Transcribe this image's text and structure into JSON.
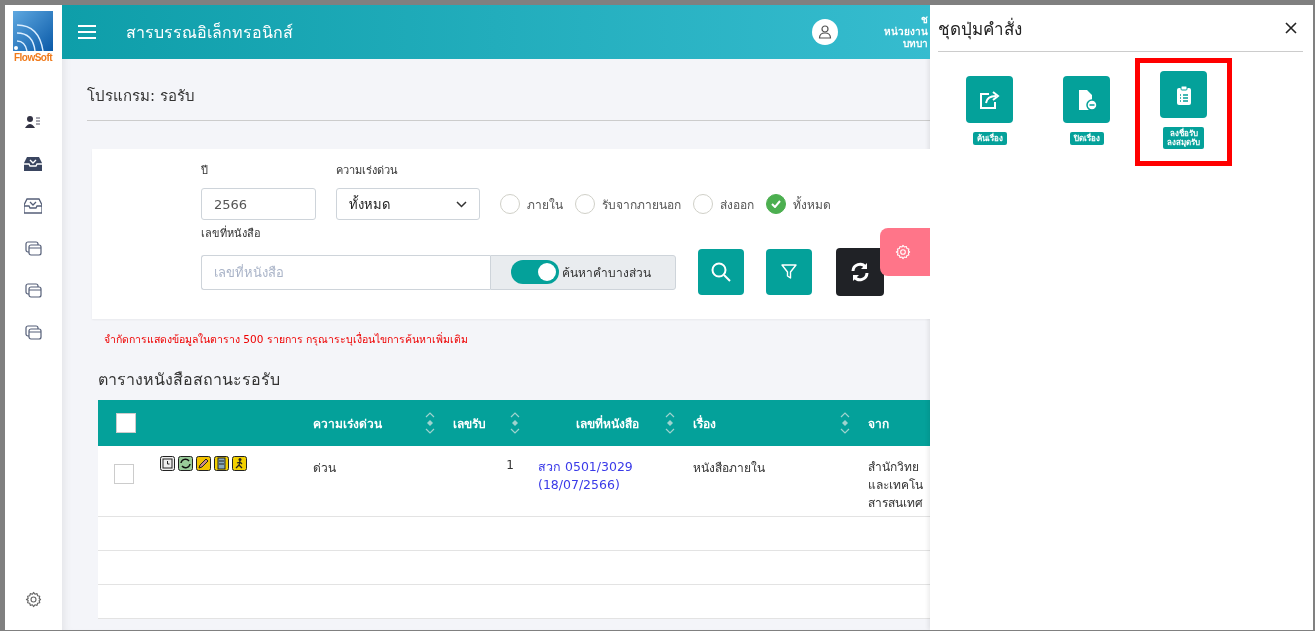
{
  "logo": {
    "text": "FlowSoft"
  },
  "header": {
    "title": "สารบรรณอิเล็กทรอนิกส์",
    "user_lines": [
      "ช",
      "หน่วยงาน",
      "บทบา"
    ]
  },
  "page": {
    "title": "โปรแกรม: รอรับ"
  },
  "filters": {
    "year": {
      "label": "ปี",
      "value": "2566"
    },
    "urgency": {
      "label": "ความเร่งด่วน",
      "value": "ทั้งหมด"
    },
    "sources": [
      {
        "label": "ภายใน",
        "selected": false
      },
      {
        "label": "รับจากภายนอก",
        "selected": false
      },
      {
        "label": "ส่งออก",
        "selected": false
      },
      {
        "label": "ทั้งหมด",
        "selected": true
      }
    ],
    "doc_number": {
      "label": "เลขที่หนังสือ",
      "placeholder": "เลขที่หนังสือ"
    },
    "partial_search": {
      "label": "ค้นหาคำบางส่วน",
      "on": true
    }
  },
  "notice": "จำกัดการแสดงข้อมูลในตาราง 500 รายการ กรุณาระบุเงื่อนไขการค้นหาเพิ่มเติม",
  "table": {
    "title": "ตารางหนังสือสถานะรอรับ",
    "all_checked": false,
    "columns": [
      {
        "label": "ความเร่งด่วน",
        "sortable": true
      },
      {
        "label": "เลขรับ",
        "sortable": true
      },
      {
        "label": "เลขที่หนังสือ",
        "sortable": true
      },
      {
        "label": "เรื่อง",
        "sortable": true
      },
      {
        "label": "จาก",
        "sortable": false
      }
    ],
    "rows": [
      {
        "checked": false,
        "urgency": "ด่วน",
        "receive_no": "1",
        "doc_no": "สวก 0501/3029",
        "doc_date": "(18/07/2566)",
        "subject": "หนังสือภายใน",
        "from": [
          "สำนักวิทย",
          "และเทคโน",
          "สารสนเทศ"
        ]
      }
    ]
  },
  "command_panel": {
    "title": "ชุดปุ่มคำสั่ง",
    "buttons": [
      {
        "label": "ค้นเรื่อง",
        "kind": "share",
        "highlighted": false
      },
      {
        "label": "ปิดเรื่อง",
        "kind": "close-file",
        "highlighted": false
      },
      {
        "label": "ลงชื่อรับ\nลงสมุดรับ",
        "kind": "clipboard",
        "highlighted": true
      }
    ]
  }
}
